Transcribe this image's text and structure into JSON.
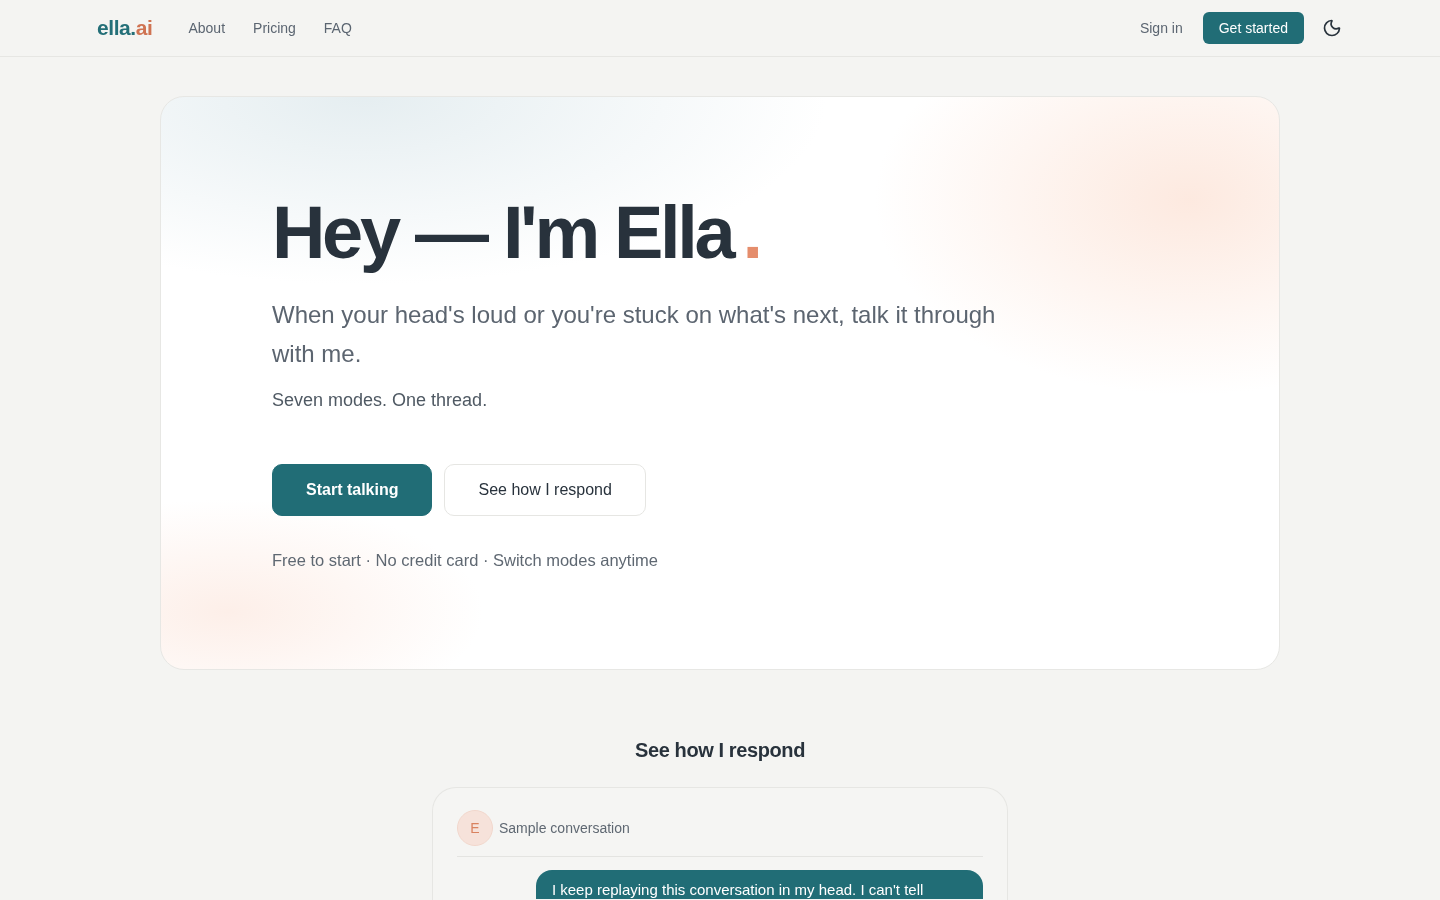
{
  "nav": {
    "logo": {
      "primary": "ella.",
      "accent": "ai"
    },
    "links": [
      "About",
      "Pricing",
      "FAQ"
    ],
    "sign_in": "Sign in",
    "cta": "Get started"
  },
  "hero": {
    "title": "Hey — I'm Ella",
    "title_accent": ".",
    "subtitle": "When your head's loud or you're stuck on what's next, talk it through with me.",
    "tagline": "Seven modes. One thread.",
    "buttons": [
      {
        "label": "Start talking",
        "kind": "primary"
      },
      {
        "label": "See how I respond",
        "kind": "secondary"
      }
    ],
    "note": "Free to start · No credit card · Switch modes anytime"
  },
  "demo": {
    "heading": "See how I respond",
    "chat": {
      "avatar_initial": "E",
      "title": "Sample conversation",
      "messages": [
        {
          "kind": "user",
          "text": "I keep replaying this conversation in my head. I can't tell"
        }
      ]
    }
  }
}
